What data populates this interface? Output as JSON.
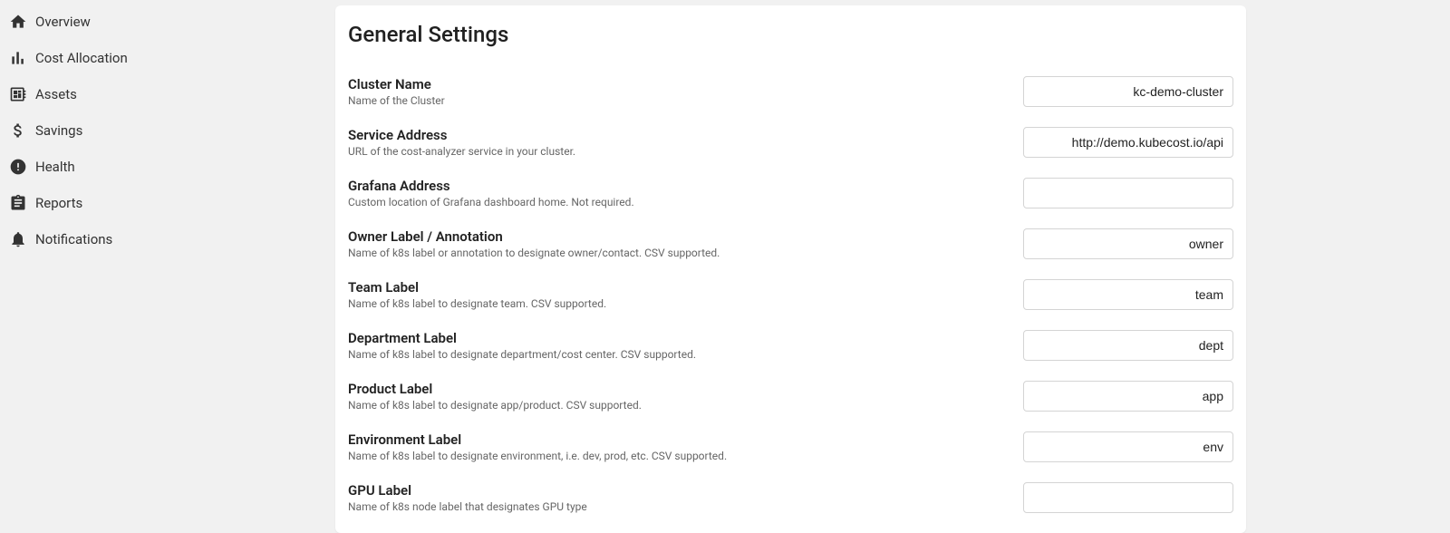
{
  "sidebar": {
    "items": [
      {
        "label": "Overview"
      },
      {
        "label": "Cost Allocation"
      },
      {
        "label": "Assets"
      },
      {
        "label": "Savings"
      },
      {
        "label": "Health"
      },
      {
        "label": "Reports"
      },
      {
        "label": "Notifications"
      }
    ]
  },
  "page": {
    "title": "General Settings"
  },
  "settings": [
    {
      "title": "Cluster Name",
      "desc": "Name of the Cluster",
      "value": "kc-demo-cluster"
    },
    {
      "title": "Service Address",
      "desc": "URL of the cost-analyzer service in your cluster.",
      "value": "http://demo.kubecost.io/api"
    },
    {
      "title": "Grafana Address",
      "desc": "Custom location of Grafana dashboard home. Not required.",
      "value": ""
    },
    {
      "title": "Owner Label / Annotation",
      "desc": "Name of k8s label or annotation to designate owner/contact. CSV supported.",
      "value": "owner"
    },
    {
      "title": "Team Label",
      "desc": "Name of k8s label to designate team. CSV supported.",
      "value": "team"
    },
    {
      "title": "Department Label",
      "desc": "Name of k8s label to designate department/cost center. CSV supported.",
      "value": "dept"
    },
    {
      "title": "Product Label",
      "desc": "Name of k8s label to designate app/product. CSV supported.",
      "value": "app"
    },
    {
      "title": "Environment Label",
      "desc": "Name of k8s label to designate environment, i.e. dev, prod, etc. CSV supported.",
      "value": "env"
    },
    {
      "title": "GPU Label",
      "desc": "Name of k8s node label that designates GPU type",
      "value": ""
    }
  ]
}
